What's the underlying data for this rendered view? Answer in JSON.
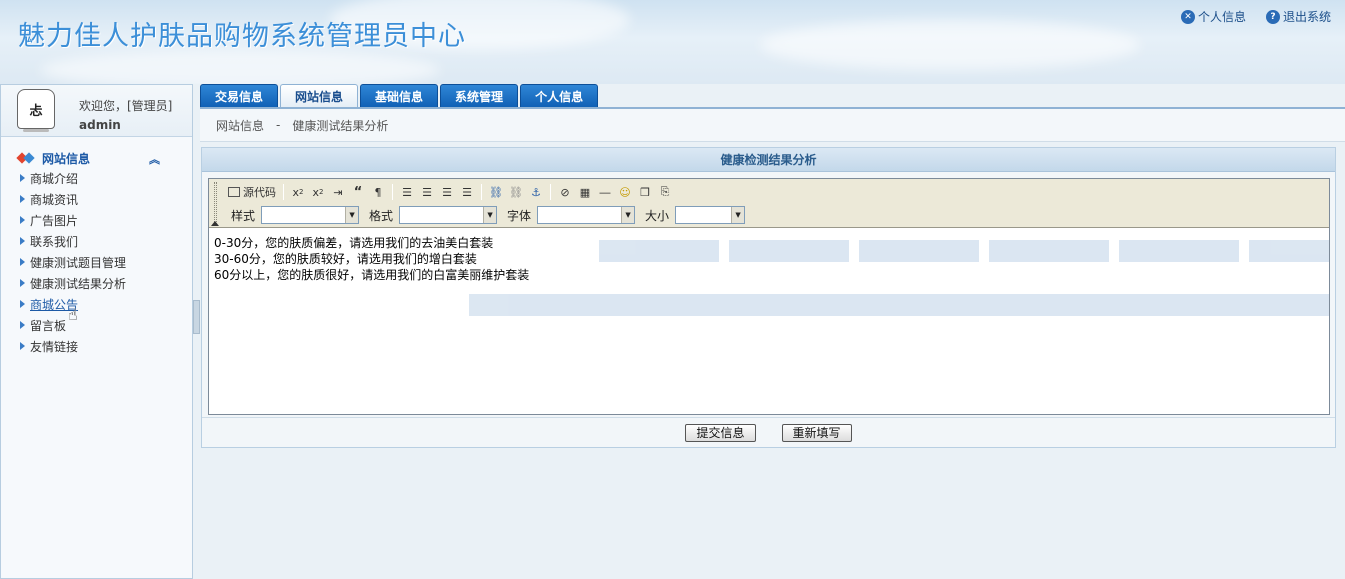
{
  "header": {
    "title": "魅力佳人护肤品购物系统管理员中心",
    "links": [
      {
        "label": "个人信息",
        "icon": "close-circle-icon"
      },
      {
        "label": "退出系统",
        "icon": "help-circle-icon"
      }
    ]
  },
  "sidebar": {
    "welcome": "欢迎您，[管理员]",
    "username": "admin",
    "avatar_text": "忐",
    "section": "网站信息",
    "items": [
      {
        "label": "商城介绍"
      },
      {
        "label": "商城资讯"
      },
      {
        "label": "广告图片"
      },
      {
        "label": "联系我们"
      },
      {
        "label": "健康测试题目管理"
      },
      {
        "label": "健康测试结果分析"
      },
      {
        "label": "商城公告"
      },
      {
        "label": "留言板"
      },
      {
        "label": "友情链接"
      }
    ]
  },
  "tabs": [
    "交易信息",
    "网站信息",
    "基础信息",
    "系统管理",
    "个人信息"
  ],
  "active_tab": "网站信息",
  "breadcrumb": {
    "section": "网站信息",
    "separator": "-",
    "page": "健康测试结果分析"
  },
  "panel": {
    "title": "健康检测结果分析",
    "toolbar": {
      "source_label": "源代码",
      "style_label": "样式",
      "format_label": "格式",
      "font_label": "字体",
      "size_label": "大小"
    },
    "content_lines": [
      "0-30分，您的肤质偏差，请选用我们的去油美白套装",
      "30-60分，您的肤质较好，请选用我们的增白套装",
      "60分以上，您的肤质很好，请选用我们的白富美丽维护套装"
    ],
    "buttons": {
      "submit": "提交信息",
      "reset": "重新填写"
    }
  },
  "colors": {
    "tab_blue": "#1a6fc4",
    "title_blue": "#3c8fd8",
    "nav_blue": "#1d5aa6"
  }
}
